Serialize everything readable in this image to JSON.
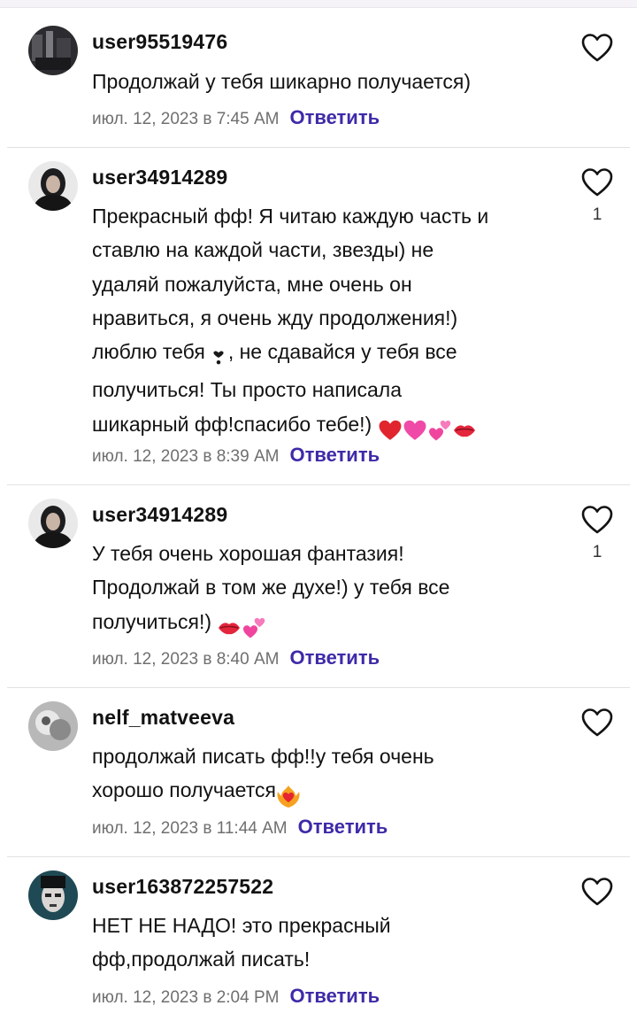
{
  "comments": [
    {
      "username": "user95519476",
      "text_lines": [
        "Продолжай у тебя шикарно получается)"
      ],
      "timestamp": "июл. 12, 2023 в 7:45 AM",
      "reply_label": "Ответить",
      "likes": ""
    },
    {
      "username": "user34914289",
      "text_lines": [
        "Прекрасный фф! Я читаю каждую часть и",
        "ставлю на каждой части, звезды) не",
        "удаляй пожалуйста, мне очень он",
        "нравиться, я очень жду продолжения!)",
        "люблю тебя",
        ", не сдавайся у тебя все",
        "получиться! Ты просто написала",
        "шикарный фф!спасибо тебе!)"
      ],
      "timestamp": "июл. 12, 2023 в 8:39 AM",
      "reply_label": "Ответить",
      "likes": "1"
    },
    {
      "username": "user34914289",
      "text_lines": [
        "У тебя очень хорошая фантазия!",
        "Продолжай в том же духе!) у тебя все",
        "получиться!)"
      ],
      "timestamp": "июл. 12, 2023 в 8:40 AM",
      "reply_label": "Ответить",
      "likes": "1"
    },
    {
      "username": "nelf_matveeva",
      "text_lines": [
        "продолжай писать фф!!у тебя очень",
        "хорошо получается"
      ],
      "timestamp": "июл. 12, 2023 в 11:44 AM",
      "reply_label": "Ответить",
      "likes": ""
    },
    {
      "username": "user163872257522",
      "text_lines": [
        "НЕТ НЕ НАДО! это прекрасный",
        "фф,продолжай писать!"
      ],
      "timestamp": "июл. 12, 2023 в 2:04 PM",
      "reply_label": "Ответить",
      "likes": ""
    }
  ],
  "icons": {
    "like": "heart-outline-icon",
    "emoji_heart": "red-heart-emoji",
    "emoji_sparkling_heart": "sparkling-heart-emoji",
    "emoji_two_hearts": "two-hearts-emoji",
    "emoji_kiss": "kiss-mark-emoji",
    "emoji_burning_heart": "heart-on-fire-emoji",
    "emoji_heart_exclamation": "heart-exclamation-emoji"
  },
  "colors": {
    "reply": "#3f2aa8",
    "timestamp": "#6f6f6f",
    "separator": "#e2e2e2"
  }
}
